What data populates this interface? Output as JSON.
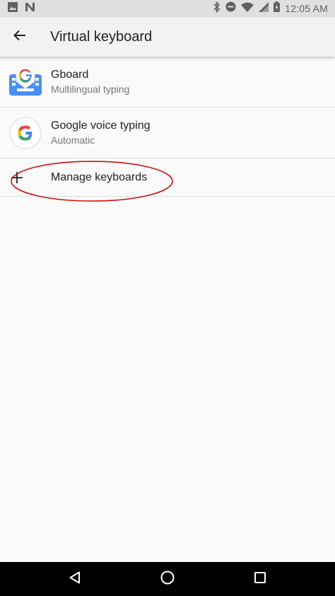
{
  "status_bar": {
    "time": "12:05 AM",
    "left_icons": [
      "image-icon",
      "n-notification-icon"
    ],
    "right_icons": [
      "bluetooth-icon",
      "do-not-disturb-icon",
      "wifi-icon",
      "signal-icon",
      "battery-icon"
    ]
  },
  "toolbar": {
    "title": "Virtual keyboard",
    "back_icon": "arrow-back-icon"
  },
  "list": {
    "items": [
      {
        "title": "Gboard",
        "subtitle": "Multilingual typing",
        "icon": "gboard-icon"
      },
      {
        "title": "Google voice typing",
        "subtitle": "Automatic",
        "icon": "google-g-icon"
      },
      {
        "title": "Manage keyboards",
        "icon": "plus-icon"
      }
    ]
  },
  "nav_bar": {
    "buttons": [
      "back-triangle-icon",
      "home-circle-icon",
      "recents-square-icon"
    ]
  },
  "colors": {
    "status_bar_bg": "#e0e0e0",
    "toolbar_bg": "#f2f2f2",
    "page_bg": "#fafafa",
    "annotation_ellipse": "#cc0000",
    "gboard_blue": "#4a8ef0"
  }
}
